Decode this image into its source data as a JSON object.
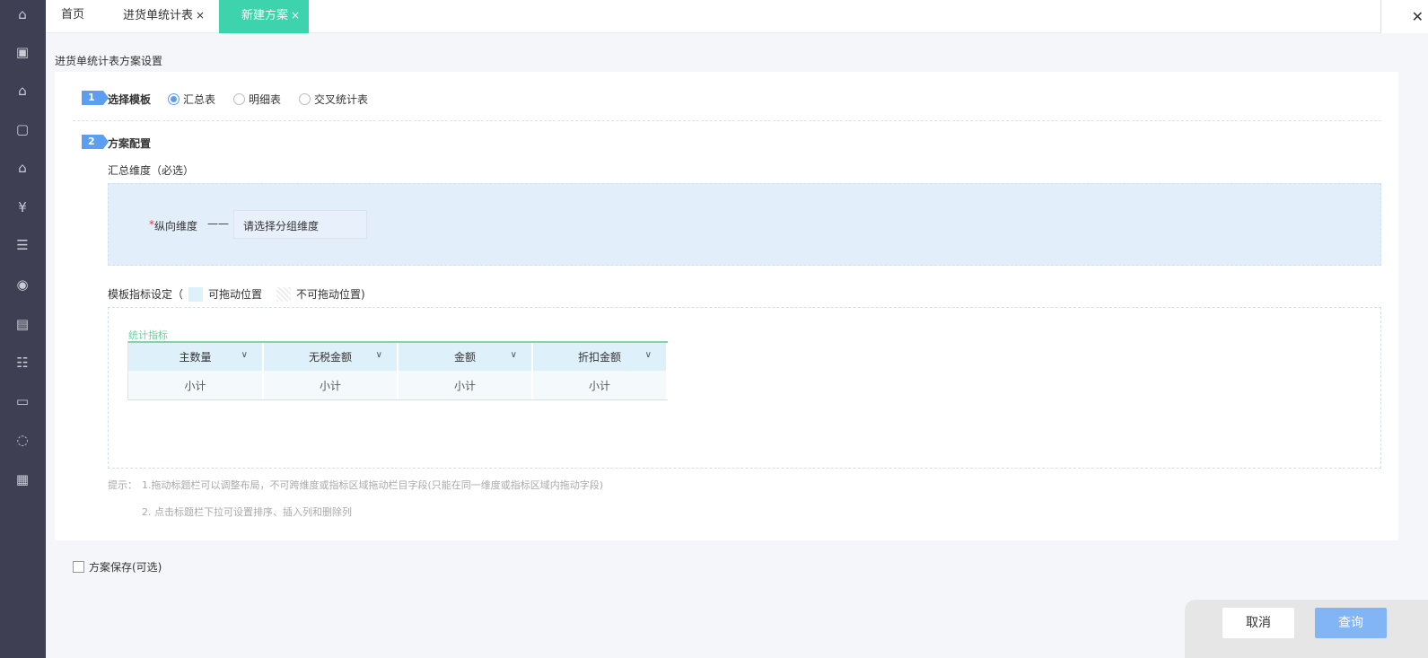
{
  "sidebar": {
    "icons": [
      "home-icon",
      "gift-icon",
      "money-house-icon",
      "bag-icon",
      "building-icon",
      "money-bag-icon",
      "invoice-icon",
      "coin-hand-icon",
      "office-icon",
      "clipboard-icon",
      "id-card-icon",
      "cycle-icon",
      "news-icon"
    ]
  },
  "tabs": [
    {
      "label": "首页"
    },
    {
      "label": "进货单统计表",
      "close": "×"
    },
    {
      "label": "新建方案",
      "close": "×"
    }
  ],
  "window_close": "✕",
  "page_title": "进货单统计表方案设置",
  "step1": {
    "num": "1",
    "title": "选择模板",
    "options": [
      "汇总表",
      "明细表",
      "交叉统计表"
    ],
    "selected": "汇总表"
  },
  "step2": {
    "num": "2",
    "title": "方案配置",
    "dim_label": "汇总维度（必选）",
    "required_mark": "*",
    "vertical_label": "纵向维度",
    "dash": "——",
    "group_placeholder": "请选择分组维度",
    "metrics_label_prefix": "模板指标设定（",
    "draggable": "可拖动位置",
    "not_draggable": "不可拖动位置)",
    "metrics_group": "统计指标",
    "columns": [
      "主数量",
      "无税金额",
      "金额",
      "折扣金额"
    ],
    "subtotals": [
      "小计",
      "小计",
      "小计",
      "小计"
    ],
    "hint_prefix": "提示：",
    "hints": [
      "1.拖动标题栏可以调整布局，不可跨维度或指标区域拖动栏目字段(只能在同一维度或指标区域内拖动字段)",
      "2. 点击标题栏下拉可设置排序、插入列和删除列"
    ]
  },
  "save_checkbox": "方案保存(可选)",
  "buttons": {
    "cancel": "取消",
    "query": "查询"
  }
}
